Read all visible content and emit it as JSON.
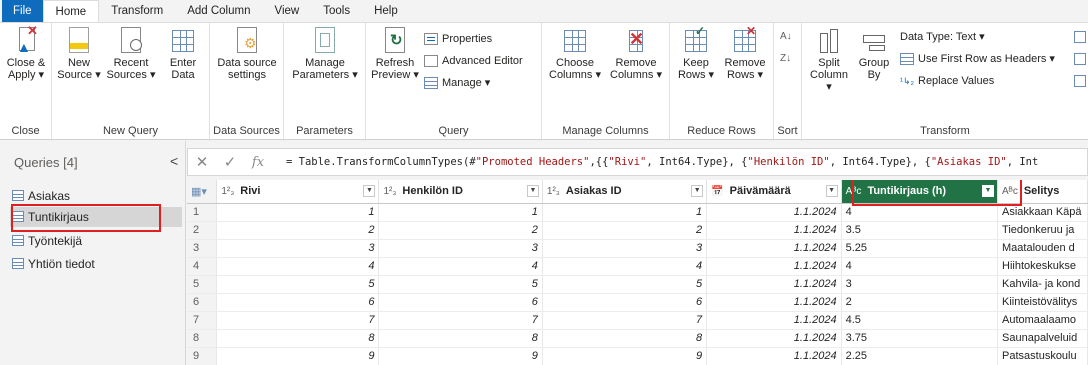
{
  "menu": {
    "tabs": [
      "File",
      "Home",
      "Transform",
      "Add Column",
      "View",
      "Tools",
      "Help"
    ]
  },
  "ribbon": {
    "close_group": {
      "label": "Close",
      "close_apply": [
        "Close &",
        "Apply ▾"
      ]
    },
    "new_query_group": {
      "label": "New Query",
      "new_source": [
        "New",
        "Source ▾"
      ],
      "recent_sources": [
        "Recent",
        "Sources ▾"
      ],
      "enter_data": [
        "Enter",
        "Data"
      ]
    },
    "data_sources_group": {
      "label": "Data Sources",
      "settings": [
        "Data source",
        "settings"
      ]
    },
    "parameters_group": {
      "label": "Parameters",
      "manage": [
        "Manage",
        "Parameters ▾"
      ]
    },
    "query_group": {
      "label": "Query",
      "refresh": [
        "Refresh",
        "Preview ▾"
      ],
      "properties": "Properties",
      "advanced_editor": "Advanced Editor",
      "manage": "Manage ▾"
    },
    "manage_columns_group": {
      "label": "Manage Columns",
      "choose": [
        "Choose",
        "Columns ▾"
      ],
      "remove": [
        "Remove",
        "Columns ▾"
      ]
    },
    "reduce_rows_group": {
      "label": "Reduce Rows",
      "keep": [
        "Keep",
        "Rows ▾"
      ],
      "remove": [
        "Remove",
        "Rows ▾"
      ]
    },
    "sort_group": {
      "label": "Sort"
    },
    "transform_group": {
      "label": "Transform",
      "split": [
        "Split",
        "Column ▾"
      ],
      "group_by": [
        "Group",
        "By"
      ],
      "data_type": "Data Type: Text ▾",
      "first_row_headers": "Use First Row as Headers ▾",
      "replace_values": "Replace Values"
    }
  },
  "queries": {
    "title": "Queries [4]",
    "collapse": "<",
    "items": [
      "Asiakas",
      "Tuntikirjaus",
      "Työntekijä",
      "Yhtiön tiedot"
    ],
    "selected_index": 1
  },
  "formula": {
    "cancel": "✕",
    "confirm": "✓",
    "fx": "fx",
    "text_prefix": "= Table.TransformColumnTypes(#\"Promoted Headers\",{{\"",
    "parts": [
      {
        "t": "= Table.TransformColumnTypes(#",
        "s": false
      },
      {
        "t": "\"Promoted Headers\"",
        "s": true
      },
      {
        "t": ",{{",
        "s": false
      },
      {
        "t": "\"Rivi\"",
        "s": true
      },
      {
        "t": ", Int64.Type}, {",
        "s": false
      },
      {
        "t": "\"Henkilön ID\"",
        "s": true
      },
      {
        "t": ", Int64.Type}, {",
        "s": false
      },
      {
        "t": "\"Asiakas ID\"",
        "s": true
      },
      {
        "t": ", Int",
        "s": false
      }
    ]
  },
  "grid": {
    "columns": [
      {
        "type": "1²₃",
        "name": "Rivi"
      },
      {
        "type": "1²₃",
        "name": "Henkilön ID"
      },
      {
        "type": "1²₃",
        "name": "Asiakas ID"
      },
      {
        "type": "📅",
        "name": "Päivämäärä"
      },
      {
        "type": "Aᴮc",
        "name": "Tuntikirjaus (h)"
      },
      {
        "type": "Aᴮc",
        "name": "Selitys"
      }
    ],
    "selected_column": 4,
    "rows": [
      [
        "1",
        "1",
        "1",
        "1",
        "1.1.2024",
        "4",
        "Asiakkaan Käpä"
      ],
      [
        "2",
        "2",
        "2",
        "2",
        "1.1.2024",
        "3.5",
        "Tiedonkeruu ja"
      ],
      [
        "3",
        "3",
        "3",
        "3",
        "1.1.2024",
        "5.25",
        "Maatalouden d"
      ],
      [
        "4",
        "4",
        "4",
        "4",
        "1.1.2024",
        "4",
        "Hiihtokeskukse"
      ],
      [
        "5",
        "5",
        "5",
        "5",
        "1.1.2024",
        "3",
        "Kahvila- ja kond"
      ],
      [
        "6",
        "6",
        "6",
        "6",
        "1.1.2024",
        "2",
        "Kiinteistövälitys"
      ],
      [
        "7",
        "7",
        "7",
        "7",
        "1.1.2024",
        "4.5",
        "Automaalaamo"
      ],
      [
        "8",
        "8",
        "8",
        "8",
        "1.1.2024",
        "3.75",
        "Saunapalveluid"
      ],
      [
        "9",
        "9",
        "9",
        "9",
        "1.1.2024",
        "2.25",
        "Patsastuskoulu"
      ]
    ]
  },
  "colors": {
    "accent": "#0f6cbd",
    "selected_header": "#217346",
    "highlight": "#e02020"
  }
}
